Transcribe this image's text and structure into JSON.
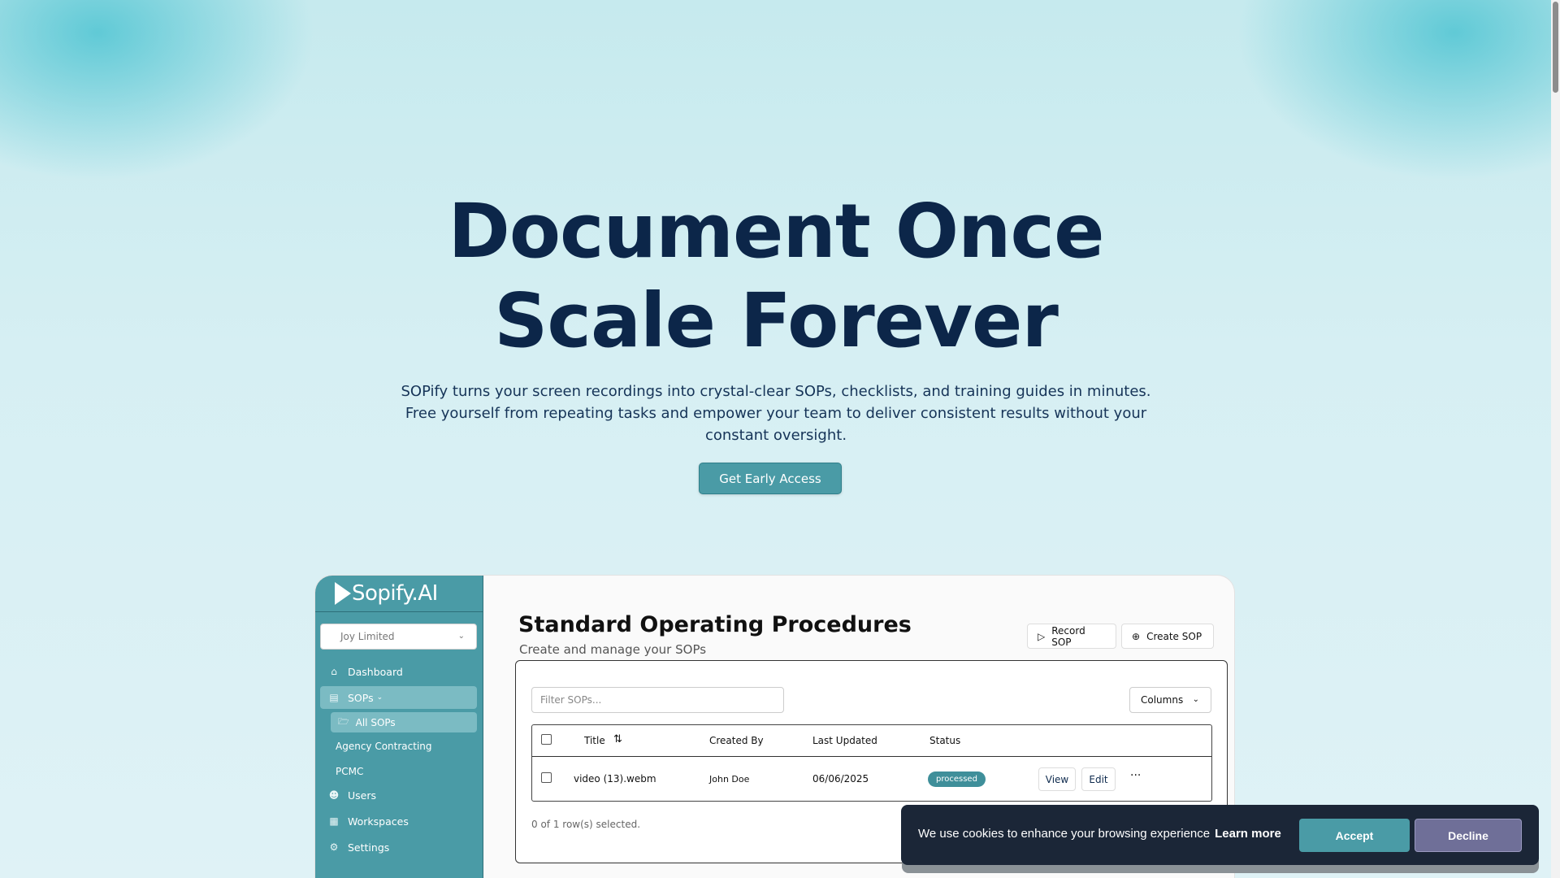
{
  "hero": {
    "title_line1": "Document Once",
    "title_line2": "Scale Forever",
    "subtitle": "SOPify turns your screen recordings into crystal-clear SOPs, checklists, and training guides in minutes. Free yourself from repeating tasks and empower your team to deliver consistent results without your constant oversight.",
    "cta_label": "Get Early Access"
  },
  "app": {
    "logo": "Sopify.AI",
    "org_select": "Joy Limited",
    "nav": {
      "dashboard": "Dashboard",
      "sops": "SOPs",
      "all_sops": "All SOPs",
      "agency_contracting": "Agency Contracting",
      "pcmc": "PCMC",
      "users": "Users",
      "workspaces": "Workspaces",
      "settings": "Settings"
    },
    "page_title": "Standard Operating Procedures",
    "page_subtitle": "Create and manage your SOPs",
    "record_sop": "Record SOP",
    "create_sop": "Create SOP",
    "filter_placeholder": "Filter SOPs...",
    "columns_label": "Columns",
    "table": {
      "headers": {
        "title": "Title",
        "created_by": "Created By",
        "last_updated": "Last Updated",
        "status": "Status"
      },
      "rows": [
        {
          "title": "video (13).webm",
          "created_by": "John Doe",
          "last_updated": "06/06/2025",
          "status": "processed",
          "view": "View",
          "edit": "Edit",
          "more": "···"
        }
      ]
    },
    "rows_selected": "0 of 1 row(s) selected."
  },
  "cookie": {
    "message": "We use cookies to enhance your browsing experience",
    "learn_more": "Learn more",
    "accept": "Accept",
    "decline": "Decline"
  },
  "colors": {
    "accent": "#4a9ba6",
    "title": "#0c2649",
    "cookie_bg": "#1b2637",
    "decline": "#6f6f98"
  }
}
